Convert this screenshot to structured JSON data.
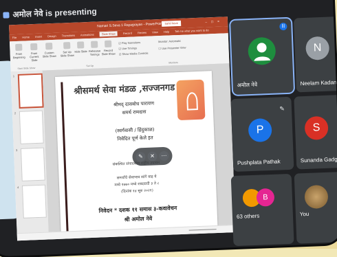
{
  "presenting_banner": "अमोल नेवे is presenting",
  "powerpoint": {
    "title": "Slide Show",
    "window_title": "Namari S.Seva 1 Rayagrayan - PowerPoint",
    "account": "Sahil Neve",
    "tabs": [
      "File",
      "Home",
      "Insert",
      "Design",
      "Transitions",
      "Animations",
      "Slide Show",
      "Record",
      "Review",
      "View",
      "Help",
      "Tell me what you want to do"
    ],
    "active_tab": "Slide Show",
    "ribbon_buttons": [
      "From Beginning",
      "From Current Slide",
      "Custom Slide Show",
      "Set Up Slide Show",
      "Hide Slide",
      "Rehearse Timings",
      "Record Slide Show"
    ],
    "ribbon_groups": [
      "Start Slide Show",
      "Set Up",
      "Monitors"
    ],
    "checkboxes": [
      "Play Narrations",
      "Use Timings",
      "Show Media Controls"
    ],
    "monitor_label": "Monitor:",
    "monitor_value": "Automatic",
    "presenter_view": "Use Presenter View"
  },
  "slide": {
    "heading": "श्रीसमर्थ सेवा मंडळ ,सज्जनगड",
    "line1": "श्रीमद् दासबोध पारायण",
    "line2": "समर्थ रामदास",
    "line3": "(स्वर्गवासी / हिंदुकाळ)",
    "line4": "निवेदित पूर्ण केले इत",
    "line5": "संकल्पित संपादकीय राष्ट्रीय उपायन",
    "line6": "समर्थांचे सेवाभाव सांगे वाह ये",
    "line7": "मध्ये १७७० मध्ये शब्दवादी ३ ते ८",
    "line8": "(दिनांक १४ सुरु २०२१)",
    "line9": "निवेदन * दशक ११ समास ३-कवावेचन",
    "line10": "श्री अमोल नेवे"
  },
  "participants": [
    {
      "name": "अमोल नेवे",
      "initial": "",
      "color": "#1e8e3e",
      "speaking": true
    },
    {
      "name": "Neelam Kadam",
      "initial": "N",
      "color": "#9aa0a6"
    },
    {
      "name": "Pushplata Pathak",
      "initial": "P",
      "color": "#1a73e8"
    },
    {
      "name": "Sunanda Gadgil",
      "initial": "S",
      "color": "#d93025"
    },
    {
      "name": "63 others",
      "initial": "B",
      "color": "#e52592"
    },
    {
      "name": "You",
      "initial": "",
      "color": "#5f6368"
    }
  ]
}
